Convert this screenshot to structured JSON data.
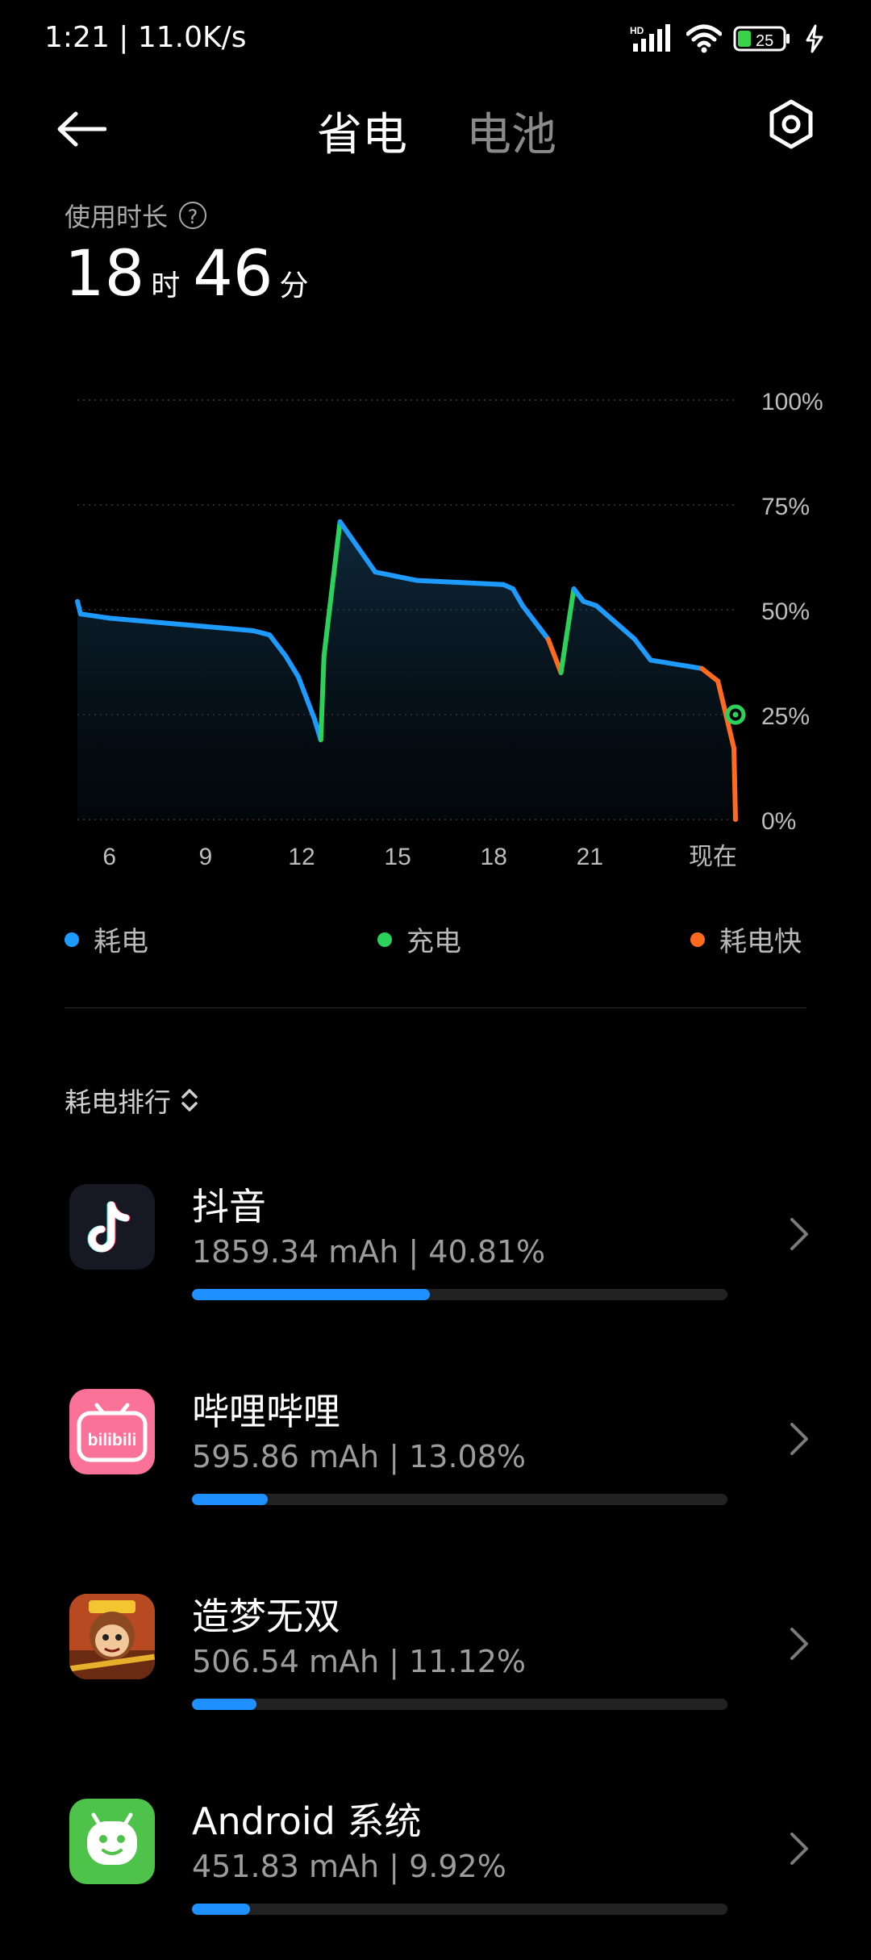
{
  "status_bar": {
    "time_speed": "1:21 | 11.0K/s",
    "network_badge": "HD",
    "battery_level": "25",
    "icons": [
      "signal-icon",
      "wifi-icon",
      "battery-icon",
      "charging-bolt-icon"
    ]
  },
  "header": {
    "tabs": [
      "省电",
      "电池"
    ],
    "active_tab": "省电",
    "icons": [
      "back-arrow-icon",
      "settings-gear-icon"
    ]
  },
  "usage": {
    "label": "使用时长",
    "hours": "18",
    "hours_unit": "时",
    "minutes": "46",
    "minutes_unit": "分"
  },
  "chart_data": {
    "type": "line",
    "y_ticks": [
      "100%",
      "75%",
      "50%",
      "25%",
      "0%"
    ],
    "ylim": [
      0,
      100
    ],
    "x_ticks": [
      "6",
      "9",
      "12",
      "15",
      "18",
      "21",
      "现在"
    ],
    "grid": true,
    "series": [
      {
        "name": "耗电",
        "color": "#1e9bff"
      },
      {
        "name": "充电",
        "color": "#2bd15a"
      },
      {
        "name": "耗电快",
        "color": "#ff6a1f"
      }
    ],
    "points": [
      [
        5.0,
        52,
        "耗电"
      ],
      [
        5.1,
        49,
        "耗电"
      ],
      [
        6.0,
        48,
        "耗电"
      ],
      [
        7.5,
        47,
        "耗电"
      ],
      [
        9.0,
        46,
        "耗电"
      ],
      [
        10.5,
        45,
        "耗电"
      ],
      [
        11.0,
        44,
        "耗电"
      ],
      [
        11.5,
        39,
        "耗电"
      ],
      [
        11.9,
        34,
        "耗电"
      ],
      [
        12.4,
        24,
        "耗电"
      ],
      [
        12.6,
        19,
        "耗电"
      ],
      [
        12.7,
        39,
        "充电"
      ],
      [
        13.2,
        71,
        "充电"
      ],
      [
        14.3,
        59,
        "耗电"
      ],
      [
        15.6,
        57,
        "耗电"
      ],
      [
        17.0,
        56.5,
        "耗电"
      ],
      [
        18.3,
        56,
        "耗电"
      ],
      [
        18.6,
        55,
        "耗电"
      ],
      [
        18.9,
        51,
        "耗电"
      ],
      [
        19.5,
        45,
        "耗电"
      ],
      [
        19.7,
        43,
        "耗电"
      ],
      [
        20.1,
        35,
        "耗电快"
      ],
      [
        20.5,
        55,
        "充电"
      ],
      [
        20.8,
        52,
        "耗电"
      ],
      [
        21.2,
        51,
        "耗电"
      ],
      [
        22.4,
        43,
        "耗电"
      ],
      [
        22.9,
        38,
        "耗电"
      ],
      [
        24.5,
        36,
        "耗电"
      ],
      [
        25.0,
        33,
        "耗电快"
      ],
      [
        25.5,
        17,
        "耗电快"
      ],
      [
        25.55,
        0,
        "耗电快"
      ]
    ],
    "current_point": {
      "x": 25.55,
      "y": 25
    }
  },
  "legend": [
    {
      "label": "耗电",
      "color": "#1e9bff"
    },
    {
      "label": "充电",
      "color": "#2bd15a"
    },
    {
      "label": "耗电快",
      "color": "#ff6a1f"
    }
  ],
  "ranking": {
    "title": "耗电排行",
    "apps": [
      {
        "name": "抖音",
        "stat": "1859.34 mAh | 40.81%",
        "percent": 40.81,
        "icon": "douyin-icon"
      },
      {
        "name": "哔哩哔哩",
        "stat": "595.86 mAh | 13.08%",
        "percent": 13.08,
        "icon": "bilibili-icon",
        "icon_text": "bilibili"
      },
      {
        "name": "造梦无双",
        "stat": "506.54 mAh | 11.12%",
        "percent": 11.12,
        "icon": "zaomeng-game-icon"
      },
      {
        "name": "Android 系统",
        "stat": "451.83 mAh | 9.92%",
        "percent": 9.92,
        "icon": "android-system-icon"
      }
    ]
  }
}
